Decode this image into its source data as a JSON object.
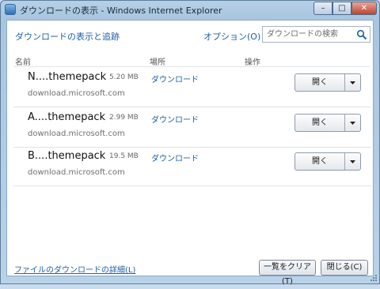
{
  "window": {
    "title": "ダウンロードの表示 - Windows Internet Explorer",
    "controls": {
      "minimize": "–",
      "maximize": "□",
      "close": "✕"
    }
  },
  "header": {
    "title": "ダウンロードの表示と追跡",
    "options_link": "オプション(O)",
    "search": {
      "placeholder": "ダウンロードの検索",
      "value": ""
    }
  },
  "columns": {
    "name": "名前",
    "place": "場所",
    "action": "操作"
  },
  "downloads": [
    {
      "name": "N....themepack",
      "size": "5.20 MB",
      "source": "download.microsoft.com",
      "place": "ダウンロード",
      "button": "開く"
    },
    {
      "name": "A....themepack",
      "size": "2.99 MB",
      "source": "download.microsoft.com",
      "place": "ダウンロード",
      "button": "開く"
    },
    {
      "name": "B....themepack",
      "size": "19.5 MB",
      "source": "download.microsoft.com",
      "place": "ダウンロード",
      "button": "開く"
    }
  ],
  "footer": {
    "details_link": "ファイルのダウンロードの詳細(L)",
    "clear_button": "一覧をクリア(T)",
    "close_button": "閉じる(C)"
  },
  "colors": {
    "link": "#1d5ea8",
    "frame": "#b6d0e6",
    "close_button": "#c0432e"
  }
}
